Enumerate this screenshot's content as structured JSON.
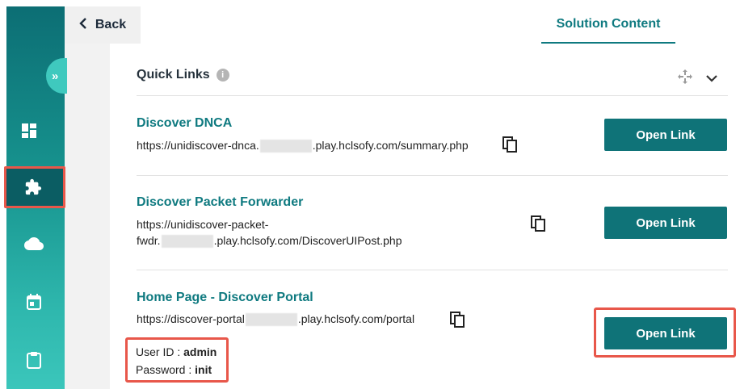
{
  "header": {
    "back_label": "Back",
    "tab_label": "Solution Content"
  },
  "sidebar": {
    "expand_glyph": "»",
    "items": [
      {
        "icon": "dashboard-icon"
      },
      {
        "icon": "puzzle-icon",
        "active": true
      },
      {
        "icon": "cloud-icon"
      },
      {
        "icon": "calendar-icon"
      },
      {
        "icon": "clipboard-icon"
      }
    ]
  },
  "quick_links": {
    "title": "Quick Links",
    "info_glyph": "i",
    "links": [
      {
        "title": "Discover DNCA",
        "url_start": "https://unidiscover-dnca.",
        "url_end": ".play.hclsofy.com/summary.php",
        "button": "Open Link"
      },
      {
        "title": "Discover Packet Forwarder",
        "url_line1": "https://unidiscover-packet-",
        "url_start": "fwdr.",
        "url_end": ".play.hclsofy.com/DiscoverUIPost.php",
        "button": "Open Link"
      },
      {
        "title": "Home Page - Discover Portal",
        "url_start": "https://discover-portal",
        "url_end": ".play.hclsofy.com/portal",
        "button": "Open Link",
        "user_id_label": "User ID : ",
        "user_id": "admin",
        "password_label": "Password : ",
        "password": "init"
      }
    ]
  },
  "colors": {
    "accent": "#0f7a80",
    "highlight": "#e8574a",
    "button": "#0f7378"
  }
}
